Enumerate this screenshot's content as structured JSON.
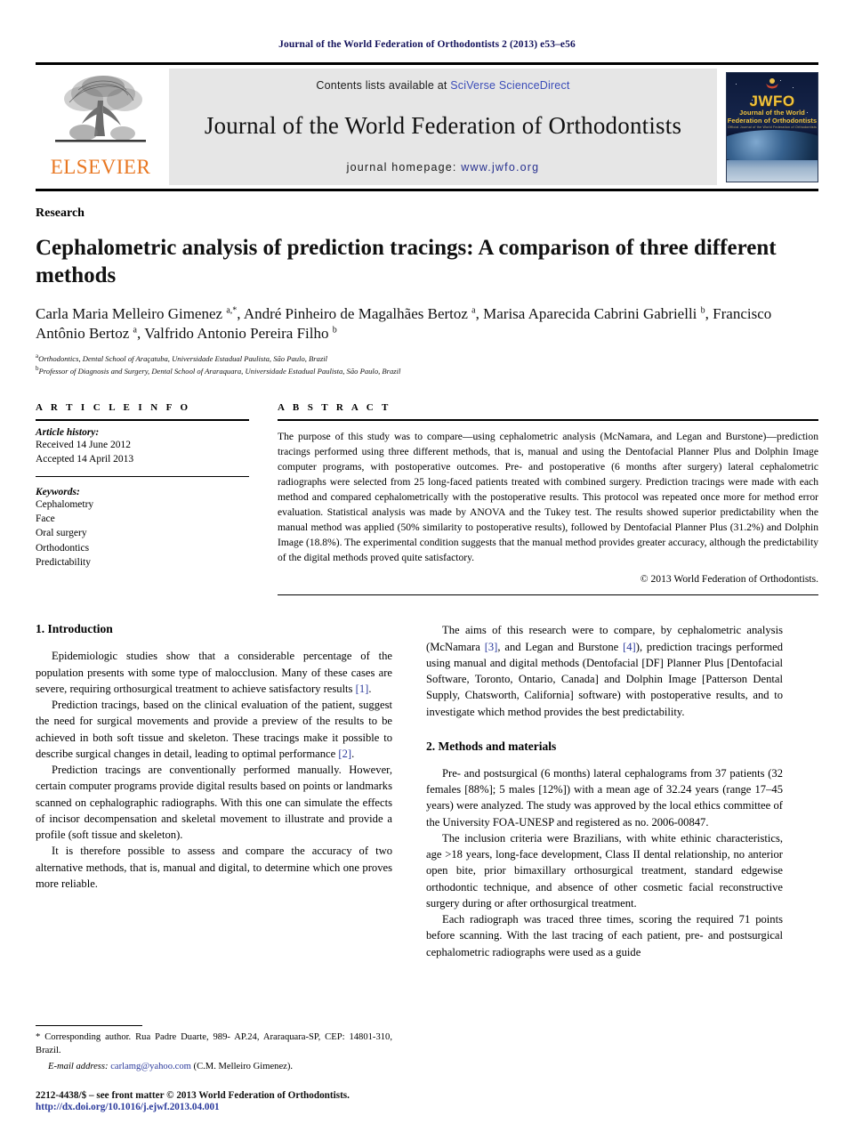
{
  "running_head": "Journal of the World Federation of Orthodontists 2 (2013) e53–e56",
  "masthead": {
    "publisher": "ELSEVIER",
    "contents_prefix": "Contents lists available at ",
    "contents_link": "SciVerse ScienceDirect",
    "journal_name": "Journal of the World Federation of Orthodontists",
    "homepage_prefix": "journal homepage: ",
    "homepage_link": "www.jwfo.org",
    "cover": {
      "acronym": "JWFO",
      "sub1": "Journal of the World",
      "sub2": "Federation of Orthodontists",
      "tiny": "Official Journal of the World Federation of Orthodontists"
    },
    "colors": {
      "link_blue": "#3b4cb8",
      "elsevier_orange": "#e87722",
      "band_gray": "#e6e6e6",
      "cover_gold": "#f0c33c"
    }
  },
  "article": {
    "section_type": "Research",
    "title": "Cephalometric analysis of prediction tracings: A comparison of three different methods",
    "authors_html": "Carla Maria Melleiro Gimenez <sup>a,</sup><sup>*</sup>, André Pinheiro de Magalhães Bertoz <sup>a</sup>, Marisa Aparecida Cabrini Gabrielli <sup>b</sup>, Francisco Antônio Bertoz <sup>a</sup>, Valfrido Antonio Pereira Filho <sup>b</sup>",
    "affiliations": [
      {
        "marker": "a",
        "text": "Orthodontics, Dental School of Araçatuba, Universidade Estadual Paulista, São Paulo, Brazil"
      },
      {
        "marker": "b",
        "text": "Professor of Diagnosis and Surgery, Dental School of Araraquara, Universidade Estadual Paulista, São Paulo, Brazil"
      }
    ]
  },
  "article_info": {
    "label": "A R T I C L E    I N F O",
    "history_title": "Article history:",
    "history_lines": [
      "Received 14 June 2012",
      "Accepted 14 April 2013"
    ],
    "keywords_title": "Keywords:",
    "keywords": [
      "Cephalometry",
      "Face",
      "Oral surgery",
      "Orthodontics",
      "Predictability"
    ]
  },
  "abstract": {
    "label": "A B S T R A C T",
    "text": "The purpose of this study was to compare—using cephalometric analysis (McNamara, and Legan and Burstone)—prediction tracings performed using three different methods, that is, manual and using the Dentofacial Planner Plus and Dolphin Image computer programs, with postoperative outcomes. Pre- and postoperative (6 months after surgery) lateral cephalometric radiographs were selected from 25 long-faced patients treated with combined surgery. Prediction tracings were made with each method and compared cephalometrically with the postoperative results. This protocol was repeated once more for method error evaluation. Statistical analysis was made by ANOVA and the Tukey test. The results showed superior predictability when the manual method was applied (50% similarity to postoperative results), followed by Dentofacial Planner Plus (31.2%) and Dolphin Image (18.8%). The experimental condition suggests that the manual method provides greater accuracy, although the predictability of the digital methods proved quite satisfactory.",
    "copyright": "© 2013 World Federation of Orthodontists."
  },
  "body": {
    "left": {
      "heading": "1.  Introduction",
      "p1_a": "Epidemiologic studies show that a considerable percentage of the population presents with some type of malocclusion. Many of these cases are severe, requiring orthosurgical treatment to achieve satisfactory results ",
      "p1_cite": "[1]",
      "p1_b": ".",
      "p2_a": "Prediction tracings, based on the clinical evaluation of the patient, suggest the need for surgical movements and provide a preview of the results to be achieved in both soft tissue and skeleton. These tracings make it possible to describe surgical changes in detail, leading to optimal performance ",
      "p2_cite": "[2]",
      "p2_b": ".",
      "p3": "Prediction tracings are conventionally performed manually. However, certain computer programs provide digital results based on points or landmarks scanned on cephalographic radiographs. With this one can simulate the effects of incisor decompensation and skeletal movement to illustrate and provide a profile (soft tissue and skeleton).",
      "p4": "It is therefore possible to assess and compare the accuracy of two alternative methods, that is, manual and digital, to determine which one proves more reliable."
    },
    "right": {
      "p1_a": "The aims of this research were to compare, by cephalometric analysis (McNamara ",
      "p1_cite1": "[3]",
      "p1_b": ", and Legan and Burstone ",
      "p1_cite2": "[4]",
      "p1_c": "), prediction tracings performed using manual and digital methods (Dentofacial [DF] Planner Plus [Dentofacial Software, Toronto, Ontario, Canada] and Dolphin Image [Patterson Dental Supply, Chatsworth, California] software) with postoperative results, and to investigate which method provides the best predictability.",
      "heading": "2.  Methods and materials",
      "p2": "Pre- and postsurgical (6 months) lateral cephalograms from 37 patients (32 females [88%]; 5 males [12%]) with a mean age of 32.24 years (range 17–45 years) were analyzed. The study was approved by the local ethics committee of the University FOA-UNESP and registered as no. 2006-00847.",
      "p3": "The inclusion criteria were Brazilians, with white ethinic characteristics, age >18 years, long-face development, Class II dental relationship, no anterior open bite, prior bimaxillary orthosurgical treatment, standard edgewise orthodontic technique, and absence of other cosmetic facial reconstructive surgery during or after orthosurgical treatment.",
      "p4": "Each radiograph was traced three times, scoring the required 71 points before scanning. With the last tracing of each patient, pre- and postsurgical cephalometric radiographs were used as a guide"
    }
  },
  "footnote": {
    "corresponding": "* Corresponding author. Rua Padre Duarte, 989- AP.24, Araraquara-SP, CEP: 14801-310, Brazil.",
    "email_label": "E-mail address: ",
    "email": "carlamg@yahoo.com",
    "email_owner": " (C.M. Melleiro Gimenez)."
  },
  "footer": {
    "issn": "2212-4438/$ – see front matter © 2013 World Federation of Orthodontists.",
    "doi": "http://dx.doi.org/10.1016/j.ejwf.2013.04.001"
  }
}
